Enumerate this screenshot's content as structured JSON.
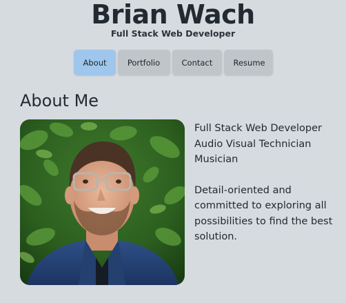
{
  "header": {
    "name": "Brian Wach",
    "subtitle": "Full Stack Web Developer"
  },
  "nav": {
    "items": [
      {
        "label": "About",
        "active": true
      },
      {
        "label": "Portfolio",
        "active": false
      },
      {
        "label": "Contact",
        "active": false
      },
      {
        "label": "Resume",
        "active": false
      }
    ]
  },
  "about": {
    "title": "About Me",
    "roles": [
      "Full Stack Web Developer",
      "Audio Visual Technician",
      "Musician"
    ],
    "bio": "Detail-oriented and committed to exploring all possibilities to find the best solution."
  },
  "colors": {
    "background": "#d6dbe0",
    "nav_button": "#c0c5ca",
    "nav_active": "#9fc6ec"
  }
}
